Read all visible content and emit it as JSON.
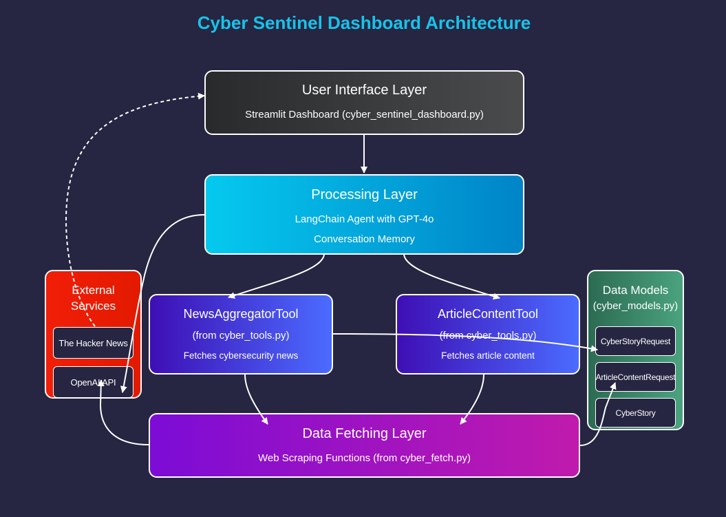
{
  "title": "Cyber Sentinel Dashboard Architecture",
  "ui_layer": {
    "title": "User Interface Layer",
    "line1": "Streamlit Dashboard (cyber_sentinel_dashboard.py)"
  },
  "processing_layer": {
    "title": "Processing Layer",
    "line1": "LangChain Agent with GPT-4o",
    "line2": "Conversation Memory"
  },
  "news_tool": {
    "title": "NewsAggregatorTool",
    "line1": "(from cyber_tools.py)",
    "line2": "Fetches cybersecurity news"
  },
  "article_tool": {
    "title": "ArticleContentTool",
    "line1": "(from cyber_tools.py)",
    "line2": "Fetches article content"
  },
  "fetch_layer": {
    "title": "Data Fetching Layer",
    "line1": "Web Scraping Functions (from cyber_fetch.py)"
  },
  "external_services": {
    "title_line1": "External",
    "title_line2": "Services",
    "items": [
      "The Hacker News",
      "OpenAI API"
    ]
  },
  "data_models": {
    "title": "Data Models",
    "subtitle": "(cyber_models.py)",
    "items": [
      "CyberStoryRequest",
      "ArticleContentRequest",
      "CyberStory"
    ]
  },
  "colors": {
    "background": "#262542",
    "title": "#15c4ea",
    "ui_layer": "#3a3b3d",
    "processing_layer": "#00a6dd",
    "tools": "#4640e0",
    "fetch_layer": "#a014c2",
    "external_services": "#ee1c05",
    "data_models": "#3a8a6a",
    "edge": "#ffffff"
  }
}
